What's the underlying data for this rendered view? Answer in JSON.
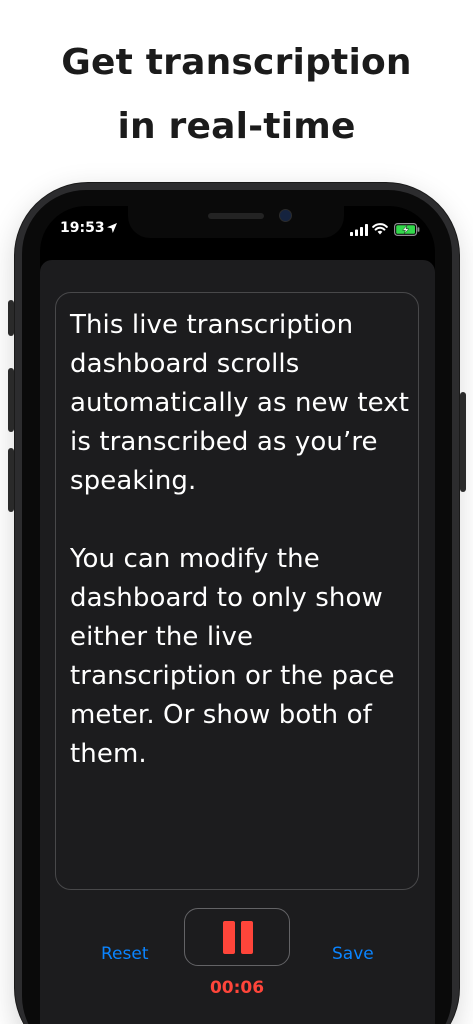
{
  "headline": {
    "line1": "Get transcription",
    "line2": "in real-time"
  },
  "status_bar": {
    "time": "19:53",
    "icons": [
      "location-arrow-icon",
      "cellular-signal-icon",
      "wifi-icon",
      "battery-charging-icon"
    ]
  },
  "transcript": {
    "text": "This live transcription dashboard scrolls automatically as new text is transcribed as you’re speaking.\n\nYou can modify the dashboard to only show either the live transcription or the pace meter. Or show both of them."
  },
  "controls": {
    "reset_label": "Reset",
    "save_label": "Save",
    "pause_icon": "pause-icon",
    "timer": "00:06"
  },
  "colors": {
    "accent_blue": "#0a84ff",
    "record_red": "#ff453a",
    "sheet_bg": "#1c1c1e",
    "battery_green": "#32d74b"
  }
}
